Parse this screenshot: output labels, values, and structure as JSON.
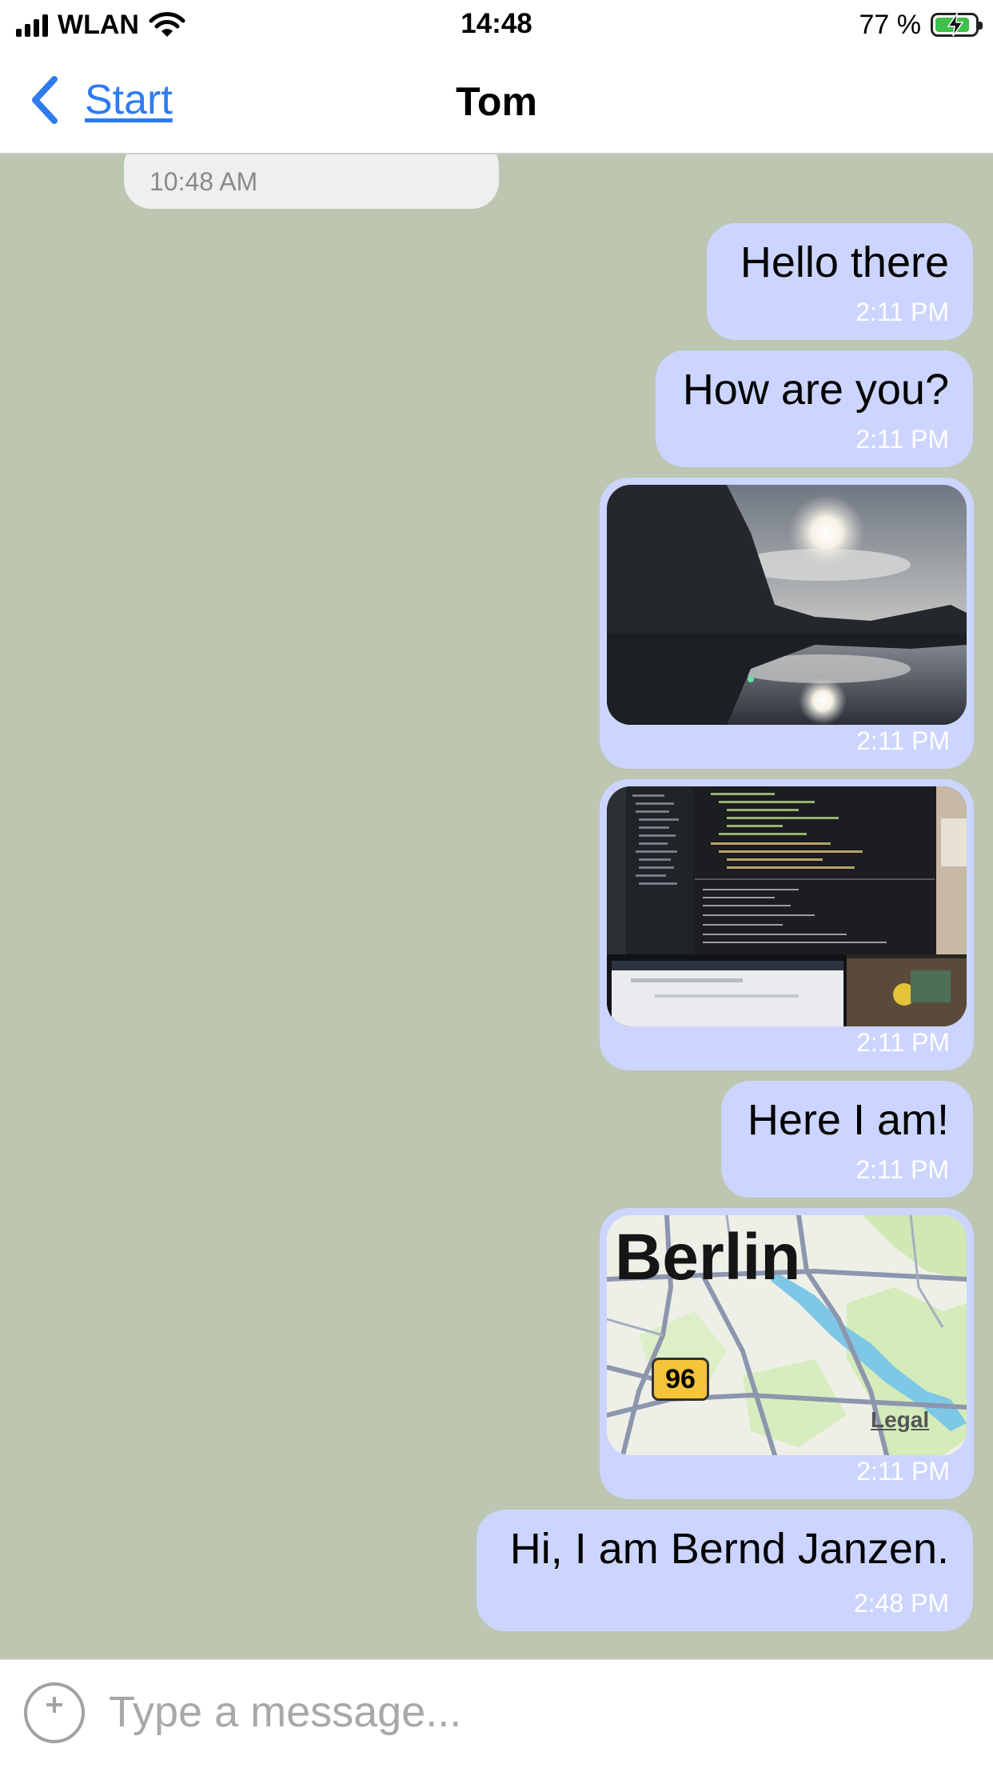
{
  "status_bar": {
    "carrier": "WLAN",
    "time": "14:48",
    "battery_percent": "77 %",
    "battery_level": 0.77,
    "signal_bars": 4,
    "icons": [
      "signal-icon",
      "wifi-icon",
      "battery-charging-icon"
    ]
  },
  "nav": {
    "back_label": "Start",
    "title": "Tom",
    "icons": [
      "chevron-left-icon"
    ]
  },
  "chat": {
    "partial_previous_time": "10:48 AM",
    "messages": [
      {
        "type": "text",
        "text": "Hello there",
        "time": "2:11 PM"
      },
      {
        "type": "text",
        "text": "How are you?",
        "time": "2:11 PM"
      },
      {
        "type": "image",
        "time": "2:11 PM"
      },
      {
        "type": "image",
        "time": "2:11 PM"
      },
      {
        "type": "text",
        "text": "Here I am!",
        "time": "2:11 PM"
      },
      {
        "type": "location",
        "city": "Berlin",
        "road": "96",
        "legal": "Legal",
        "time": "2:11 PM"
      },
      {
        "type": "text",
        "text": "Hi, I am Bernd Janzen.",
        "time": "2:48 PM"
      }
    ]
  },
  "composer": {
    "placeholder": "Type a message...",
    "icons": [
      "add-attachment-icon"
    ]
  },
  "colors": {
    "chat_background": "#bcc6b0",
    "outgoing_bubble": "#ccd5ff",
    "accent": "#2f7bf0",
    "battery": "#3fc04a"
  }
}
